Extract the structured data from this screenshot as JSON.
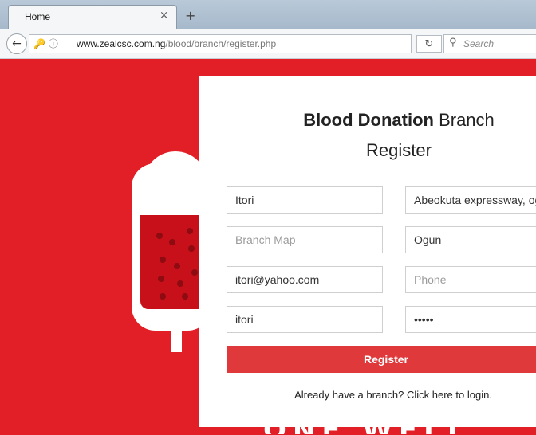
{
  "browser": {
    "tab_title": "Home",
    "tab_close": "×",
    "new_tab": "+",
    "url_domain": "www.zealcsc.com.ng",
    "url_path": "/blood/branch/register.php",
    "search_placeholder": "Search"
  },
  "form": {
    "title_bold": "Blood Donation",
    "title_rest": " Branch",
    "title_line2": "Register",
    "fields": {
      "branch_name": {
        "value": "Itori",
        "placeholder": ""
      },
      "address": {
        "value": "Abeokuta expressway, ogun state",
        "placeholder": ""
      },
      "branch_map": {
        "value": "",
        "placeholder": "Branch Map"
      },
      "state": {
        "value": "Ogun",
        "placeholder": ""
      },
      "email": {
        "value": "itori@yahoo.com",
        "placeholder": ""
      },
      "phone": {
        "value": "",
        "placeholder": "Phone"
      },
      "username": {
        "value": "itori",
        "placeholder": ""
      },
      "password": {
        "value": "itori",
        "placeholder": ""
      }
    },
    "register_label": "Register",
    "login_text": "Already have a branch? Click here to login."
  },
  "background": {
    "bottom_text": "ONE WELL"
  },
  "colors": {
    "brand_red": "#e21f26",
    "button_red": "#e0393c"
  }
}
